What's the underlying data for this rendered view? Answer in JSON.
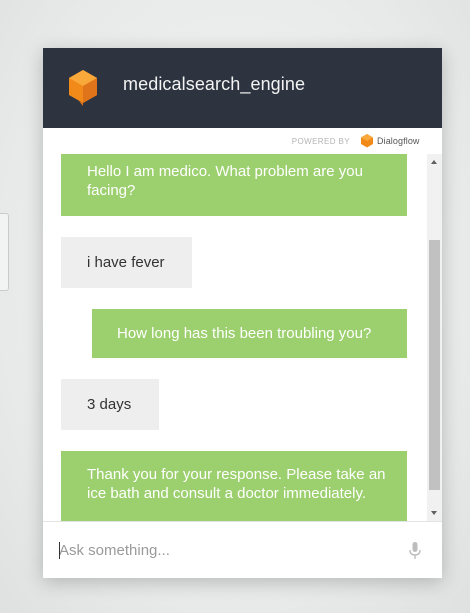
{
  "header": {
    "title": "medicalsearch_engine",
    "logo_icon": "dialogflow-agent-cube-icon",
    "background_color": "#2d3440"
  },
  "powered_by": {
    "label": "POWERED BY",
    "brand": "Dialogflow",
    "brand_icon": "dialogflow-logo-icon"
  },
  "messages": [
    {
      "sender": "bot",
      "text": "Hello I am medico. What problem are you facing?"
    },
    {
      "sender": "user",
      "text": "i have fever"
    },
    {
      "sender": "bot",
      "text": "How long has this been troubling you?"
    },
    {
      "sender": "user",
      "text": "3 days"
    },
    {
      "sender": "bot",
      "text": "Thank you for your response. Please take an ice bath and consult a doctor immediately."
    }
  ],
  "input": {
    "placeholder": "Ask something...",
    "value": "",
    "mic_icon": "microphone-icon"
  },
  "colors": {
    "bot_bubble": "#9ccf6e",
    "user_bubble": "#eeeeee",
    "accent_orange": "#f28a1a"
  }
}
